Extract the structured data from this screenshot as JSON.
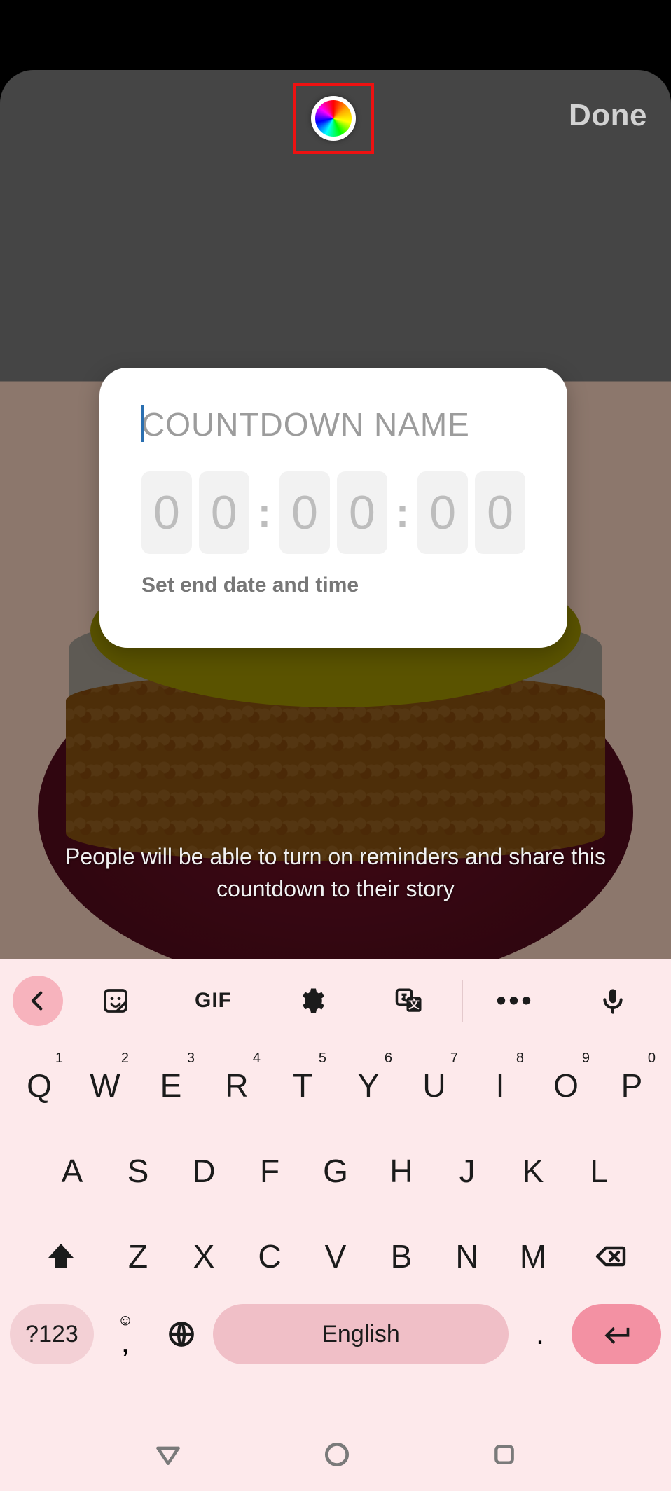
{
  "header": {
    "done_label": "Done",
    "color_picker_name": "color-picker"
  },
  "countdown": {
    "name_placeholder": "COUNTDOWN NAME",
    "name_value": "",
    "digits": [
      "0",
      "0",
      "0",
      "0",
      "0",
      "0"
    ],
    "hint": "Set end date and time"
  },
  "info_text": "People will be able to turn on reminders and share this countdown to their story",
  "keyboard": {
    "toolbar": {
      "gif_label": "GIF"
    },
    "row1": [
      {
        "k": "Q",
        "n": "1"
      },
      {
        "k": "W",
        "n": "2"
      },
      {
        "k": "E",
        "n": "3"
      },
      {
        "k": "R",
        "n": "4"
      },
      {
        "k": "T",
        "n": "5"
      },
      {
        "k": "Y",
        "n": "6"
      },
      {
        "k": "U",
        "n": "7"
      },
      {
        "k": "I",
        "n": "8"
      },
      {
        "k": "O",
        "n": "9"
      },
      {
        "k": "P",
        "n": "0"
      }
    ],
    "row2": [
      "A",
      "S",
      "D",
      "F",
      "G",
      "H",
      "J",
      "K",
      "L"
    ],
    "row3": [
      "Z",
      "X",
      "C",
      "V",
      "B",
      "N",
      "M"
    ],
    "symbols_label": "?123",
    "comma": ",",
    "space_label": "English",
    "period": "."
  }
}
